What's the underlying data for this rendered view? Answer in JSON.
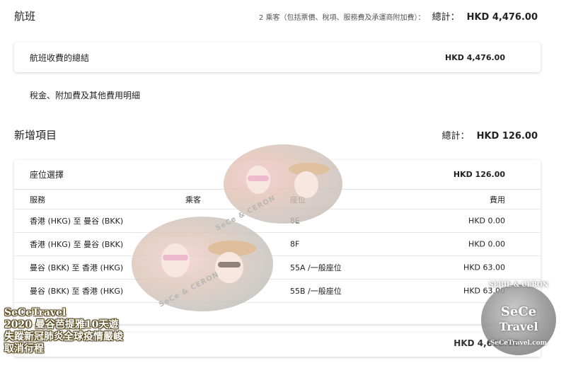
{
  "flight": {
    "title": "航班",
    "note": "2 乘客（包括票價、稅項、服務費及承運商附加費）：",
    "total_label": "總計：",
    "total_value": "HKD 4,476.00"
  },
  "fare_summary": {
    "label": "航班收費的總結",
    "value": "HKD 4,476.00"
  },
  "tax_link": "稅金、附加費及其他費用明細",
  "addons": {
    "title": "新增項目",
    "total_label": "總計：",
    "total_value": "HKD 126.00"
  },
  "seat_selection": {
    "title": "座位選擇",
    "sum": "HKD 126.00",
    "columns": {
      "service": "服務",
      "passenger": "乘客",
      "seat": "座位",
      "fee": "費用"
    },
    "rows": [
      {
        "service": "香港 (HKG) 至 曼谷 (BKK)",
        "passenger": "",
        "seat": "8E",
        "fee": "HKD 0.00"
      },
      {
        "service": "香港 (HKG) 至 曼谷 (BKK)",
        "passenger": "",
        "seat": "8F",
        "fee": "HKD 0.00"
      },
      {
        "service": "曼谷 (BKK) 至 香港 (HKG)",
        "passenger": "",
        "seat": "55A /一般座位",
        "fee": "HKD 63.00"
      },
      {
        "service": "曼谷 (BKK) 至 香港 (HKG)",
        "passenger": "",
        "seat": "55B /一般座位",
        "fee": "HKD 63.00"
      }
    ]
  },
  "grand_total": "HKD 4,602.00",
  "overlay": {
    "watermark_small": "SeCe & CERON",
    "caption_lines": [
      "SeCeTravel",
      "2020 曼谷芭提雅10天遊",
      "失蹤新冠肺炎全球疫情嚴峻",
      "取消行程"
    ],
    "badge_top": "SEBIE & CERON",
    "badge_main1": "SeCe",
    "badge_main2": "Travel",
    "badge_bottom": "SeCeTravel.com"
  }
}
